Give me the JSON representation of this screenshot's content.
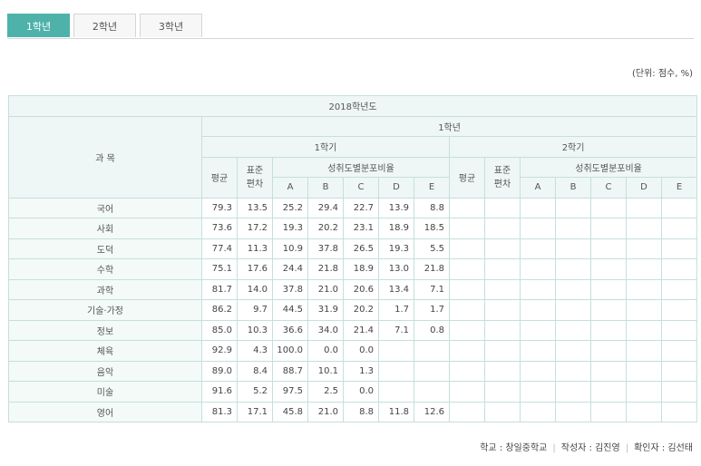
{
  "tabs": [
    "1학년",
    "2학년",
    "3학년"
  ],
  "unit_note": "(단위: 점수, %)",
  "table": {
    "year": "2018학년도",
    "grade": "1학년",
    "subject_header": "과 목",
    "semester1": "1학기",
    "semester2": "2학기",
    "avg": "평균",
    "std": "표준\n편차",
    "dist": "성취도별분포비율",
    "levels": [
      "A",
      "B",
      "C",
      "D",
      "E"
    ],
    "rows": [
      {
        "subject": "국어",
        "v": [
          "79.3",
          "13.5",
          "25.2",
          "29.4",
          "22.7",
          "13.9",
          "8.8"
        ]
      },
      {
        "subject": "사회",
        "v": [
          "73.6",
          "17.2",
          "19.3",
          "20.2",
          "23.1",
          "18.9",
          "18.5"
        ]
      },
      {
        "subject": "도덕",
        "v": [
          "77.4",
          "11.3",
          "10.9",
          "37.8",
          "26.5",
          "19.3",
          "5.5"
        ]
      },
      {
        "subject": "수학",
        "v": [
          "75.1",
          "17.6",
          "24.4",
          "21.8",
          "18.9",
          "13.0",
          "21.8"
        ]
      },
      {
        "subject": "과학",
        "v": [
          "81.7",
          "14.0",
          "37.8",
          "21.0",
          "20.6",
          "13.4",
          "7.1"
        ]
      },
      {
        "subject": "기술·가정",
        "v": [
          "86.2",
          "9.7",
          "44.5",
          "31.9",
          "20.2",
          "1.7",
          "1.7"
        ]
      },
      {
        "subject": "정보",
        "v": [
          "85.0",
          "10.3",
          "36.6",
          "34.0",
          "21.4",
          "7.1",
          "0.8"
        ]
      },
      {
        "subject": "체육",
        "v": [
          "92.9",
          "4.3",
          "100.0",
          "0.0",
          "0.0",
          "",
          ""
        ]
      },
      {
        "subject": "음악",
        "v": [
          "89.0",
          "8.4",
          "88.7",
          "10.1",
          "1.3",
          "",
          ""
        ]
      },
      {
        "subject": "미술",
        "v": [
          "91.6",
          "5.2",
          "97.5",
          "2.5",
          "0.0",
          "",
          ""
        ]
      },
      {
        "subject": "영어",
        "v": [
          "81.3",
          "17.1",
          "45.8",
          "21.0",
          "8.8",
          "11.8",
          "12.6"
        ]
      }
    ]
  },
  "footer": {
    "school": "학교 : 창일중학교",
    "writer": "작성자 : 김진영",
    "checker": "확인자 : 김선태"
  }
}
